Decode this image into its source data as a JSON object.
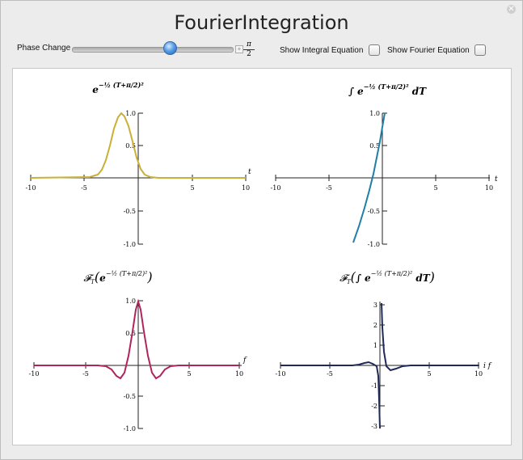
{
  "window": {
    "title": "FourierIntegration"
  },
  "controls": {
    "phase_label": "Phase Change",
    "phase_value_num": "π",
    "phase_value_den": "2",
    "phase_value": 0.5,
    "show_integral_label": "Show Integral Equation",
    "show_fourier_label": "Show Fourier Equation",
    "show_integral_checked": false,
    "show_fourier_checked": false
  },
  "colors": {
    "gaussian": "#c9b037",
    "integral": "#1f7fa6",
    "fourier": "#b0245d",
    "fourier_integral": "#1f2a55",
    "slider_thumb": "#3b82d6"
  },
  "plots": [
    {
      "name": "gaussian",
      "formula_label": "e^(-1/2 (T+π/2)^2)",
      "x_axis_label": "t",
      "y_ticks": [
        "1.0",
        "0.5",
        "-0.5",
        "-1.0"
      ],
      "x_ticks": [
        "-10",
        "-5",
        "5",
        "10"
      ]
    },
    {
      "name": "integral-of-gaussian",
      "formula_label": "∫ e^(-1/2 (T+π/2)^2) dT",
      "x_axis_label": "t",
      "y_ticks": [
        "1.0",
        "0.5",
        "-0.5",
        "-1.0"
      ],
      "x_ticks": [
        "-10",
        "-5",
        "5",
        "10"
      ]
    },
    {
      "name": "fourier-of-gaussian",
      "formula_label": "𝓕T ( e^(-1/2 (T+π/2)^2) )",
      "x_axis_label": "f",
      "y_ticks": [
        "1.0",
        "0.5",
        "-0.5",
        "-1.0"
      ],
      "x_ticks": [
        "-10",
        "-5",
        "5",
        "10"
      ]
    },
    {
      "name": "fourier-of-integral",
      "formula_label": "𝓕T ( ∫ e^(-1/2 (T+π/2)^2) dT )",
      "x_axis_label": "i f",
      "y_ticks": [
        "3",
        "2",
        "1",
        "-1",
        "-2",
        "-3"
      ],
      "x_ticks": [
        "-10",
        "-5",
        "5",
        "10"
      ]
    }
  ]
}
